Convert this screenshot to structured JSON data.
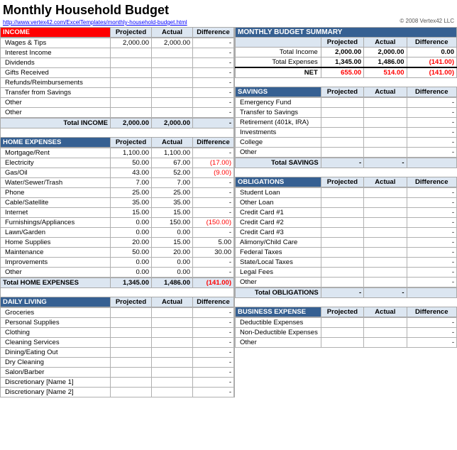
{
  "title": "Monthly Household Budget",
  "url": "http://www.vertex42.com/ExcelTemplates/monthly-household-budget.html",
  "copyright": "© 2008 Vertex42 LLC",
  "left": {
    "income_section": {
      "header": "INCOME",
      "col_projected": "Projected",
      "col_actual": "Actual",
      "col_difference": "Difference",
      "rows": [
        {
          "label": "Wages & Tips",
          "projected": "2,000.00",
          "actual": "2,000.00",
          "diff": "-"
        },
        {
          "label": "Interest Income",
          "projected": "",
          "actual": "",
          "diff": "-"
        },
        {
          "label": "Dividends",
          "projected": "",
          "actual": "",
          "diff": "-"
        },
        {
          "label": "Gifts Received",
          "projected": "",
          "actual": "",
          "diff": "-"
        },
        {
          "label": "Refunds/Reimbursements",
          "projected": "",
          "actual": "",
          "diff": "-"
        },
        {
          "label": "Transfer from Savings",
          "projected": "",
          "actual": "",
          "diff": "-"
        },
        {
          "label": "Other",
          "projected": "",
          "actual": "",
          "diff": "-"
        },
        {
          "label": "Other",
          "projected": "",
          "actual": "",
          "diff": "-"
        }
      ],
      "total_label": "Total INCOME",
      "total_projected": "2,000.00",
      "total_actual": "2,000.00",
      "total_diff": "-"
    },
    "home_section": {
      "header": "HOME EXPENSES",
      "col_projected": "Projected",
      "col_actual": "Actual",
      "col_difference": "Difference",
      "rows": [
        {
          "label": "Mortgage/Rent",
          "projected": "1,100.00",
          "actual": "1,100.00",
          "diff": "-"
        },
        {
          "label": "Electricity",
          "projected": "50.00",
          "actual": "67.00",
          "diff": "(17.00)"
        },
        {
          "label": "Gas/Oil",
          "projected": "43.00",
          "actual": "52.00",
          "diff": "(9.00)"
        },
        {
          "label": "Water/Sewer/Trash",
          "projected": "7.00",
          "actual": "7.00",
          "diff": "-"
        },
        {
          "label": "Phone",
          "projected": "25.00",
          "actual": "25.00",
          "diff": "-"
        },
        {
          "label": "Cable/Satellite",
          "projected": "35.00",
          "actual": "35.00",
          "diff": "-"
        },
        {
          "label": "Internet",
          "projected": "15.00",
          "actual": "15.00",
          "diff": "-"
        },
        {
          "label": "Furnishings/Appliances",
          "projected": "0.00",
          "actual": "150.00",
          "diff": "(150.00)"
        },
        {
          "label": "Lawn/Garden",
          "projected": "0.00",
          "actual": "0.00",
          "diff": "-"
        },
        {
          "label": "Home Supplies",
          "projected": "20.00",
          "actual": "15.00",
          "diff": "5.00"
        },
        {
          "label": "Maintenance",
          "projected": "50.00",
          "actual": "20.00",
          "diff": "30.00"
        },
        {
          "label": "Improvements",
          "projected": "0.00",
          "actual": "0.00",
          "diff": "-"
        },
        {
          "label": "Other",
          "projected": "0.00",
          "actual": "0.00",
          "diff": "-"
        }
      ],
      "total_label": "Total HOME EXPENSES",
      "total_projected": "1,345.00",
      "total_actual": "1,486.00",
      "total_diff": "(141.00)"
    },
    "daily_section": {
      "header": "DAILY LIVING",
      "col_projected": "Projected",
      "col_actual": "Actual",
      "col_difference": "Difference",
      "rows": [
        {
          "label": "Groceries",
          "projected": "",
          "actual": "",
          "diff": "-"
        },
        {
          "label": "Personal Supplies",
          "projected": "",
          "actual": "",
          "diff": "-"
        },
        {
          "label": "Clothing",
          "projected": "",
          "actual": "",
          "diff": "-"
        },
        {
          "label": "Cleaning Services",
          "projected": "",
          "actual": "",
          "diff": "-"
        },
        {
          "label": "Dining/Eating Out",
          "projected": "",
          "actual": "",
          "diff": "-"
        },
        {
          "label": "Dry Cleaning",
          "projected": "",
          "actual": "",
          "diff": "-"
        },
        {
          "label": "Salon/Barber",
          "projected": "",
          "actual": "",
          "diff": "-"
        },
        {
          "label": "Discretionary [Name 1]",
          "projected": "",
          "actual": "",
          "diff": "-"
        },
        {
          "label": "Discretionary [Name 2]",
          "projected": "",
          "actual": "",
          "diff": "-"
        }
      ]
    }
  },
  "right": {
    "summary_section": {
      "header": "MONTHLY BUDGET SUMMARY",
      "col_projected": "Projected",
      "col_actual": "Actual",
      "col_difference": "Difference",
      "rows": [
        {
          "label": "Total Income",
          "projected": "2,000.00",
          "actual": "2,000.00",
          "diff": "0.00"
        },
        {
          "label": "Total Expenses",
          "projected": "1,345.00",
          "actual": "1,486.00",
          "diff": "(141.00)"
        },
        {
          "label": "NET",
          "projected": "655.00",
          "actual": "514.00",
          "diff": "(141.00)"
        }
      ]
    },
    "savings_section": {
      "header": "SAVINGS",
      "col_projected": "Projected",
      "col_actual": "Actual",
      "col_difference": "Difference",
      "rows": [
        {
          "label": "Emergency Fund",
          "projected": "",
          "actual": "",
          "diff": "-"
        },
        {
          "label": "Transfer to Savings",
          "projected": "",
          "actual": "",
          "diff": "-"
        },
        {
          "label": "Retirement (401k, IRA)",
          "projected": "",
          "actual": "",
          "diff": "-"
        },
        {
          "label": "Investments",
          "projected": "",
          "actual": "",
          "diff": "-"
        },
        {
          "label": "College",
          "projected": "",
          "actual": "",
          "diff": "-"
        },
        {
          "label": "Other",
          "projected": "",
          "actual": "",
          "diff": "-"
        }
      ],
      "total_label": "Total SAVINGS",
      "total_projected": "-",
      "total_actual": "-",
      "total_diff": ""
    },
    "obligations_section": {
      "header": "OBLIGATIONS",
      "col_projected": "Projected",
      "col_actual": "Actual",
      "col_difference": "Difference",
      "rows": [
        {
          "label": "Student Loan",
          "projected": "",
          "actual": "",
          "diff": "-"
        },
        {
          "label": "Other Loan",
          "projected": "",
          "actual": "",
          "diff": "-"
        },
        {
          "label": "Credit Card #1",
          "projected": "",
          "actual": "",
          "diff": "-"
        },
        {
          "label": "Credit Card #2",
          "projected": "",
          "actual": "",
          "diff": "-"
        },
        {
          "label": "Credit Card #3",
          "projected": "",
          "actual": "",
          "diff": "-"
        },
        {
          "label": "Alimony/Child Care",
          "projected": "",
          "actual": "",
          "diff": "-"
        },
        {
          "label": "Federal Taxes",
          "projected": "",
          "actual": "",
          "diff": "-"
        },
        {
          "label": "State/Local Taxes",
          "projected": "",
          "actual": "",
          "diff": "-"
        },
        {
          "label": "Legal Fees",
          "projected": "",
          "actual": "",
          "diff": "-"
        },
        {
          "label": "Other",
          "projected": "",
          "actual": "",
          "diff": "-"
        }
      ],
      "total_label": "Total OBLIGATIONS",
      "total_projected": "-",
      "total_actual": "-",
      "total_diff": ""
    },
    "business_section": {
      "header": "BUSINESS EXPENSE",
      "col_projected": "Projected",
      "col_actual": "Actual",
      "col_difference": "Difference",
      "rows": [
        {
          "label": "Deductible Expenses",
          "projected": "",
          "actual": "",
          "diff": "-"
        },
        {
          "label": "Non-Deductible Expenses",
          "projected": "",
          "actual": "",
          "diff": "-"
        },
        {
          "label": "Other",
          "projected": "",
          "actual": "",
          "diff": "-"
        }
      ]
    }
  }
}
